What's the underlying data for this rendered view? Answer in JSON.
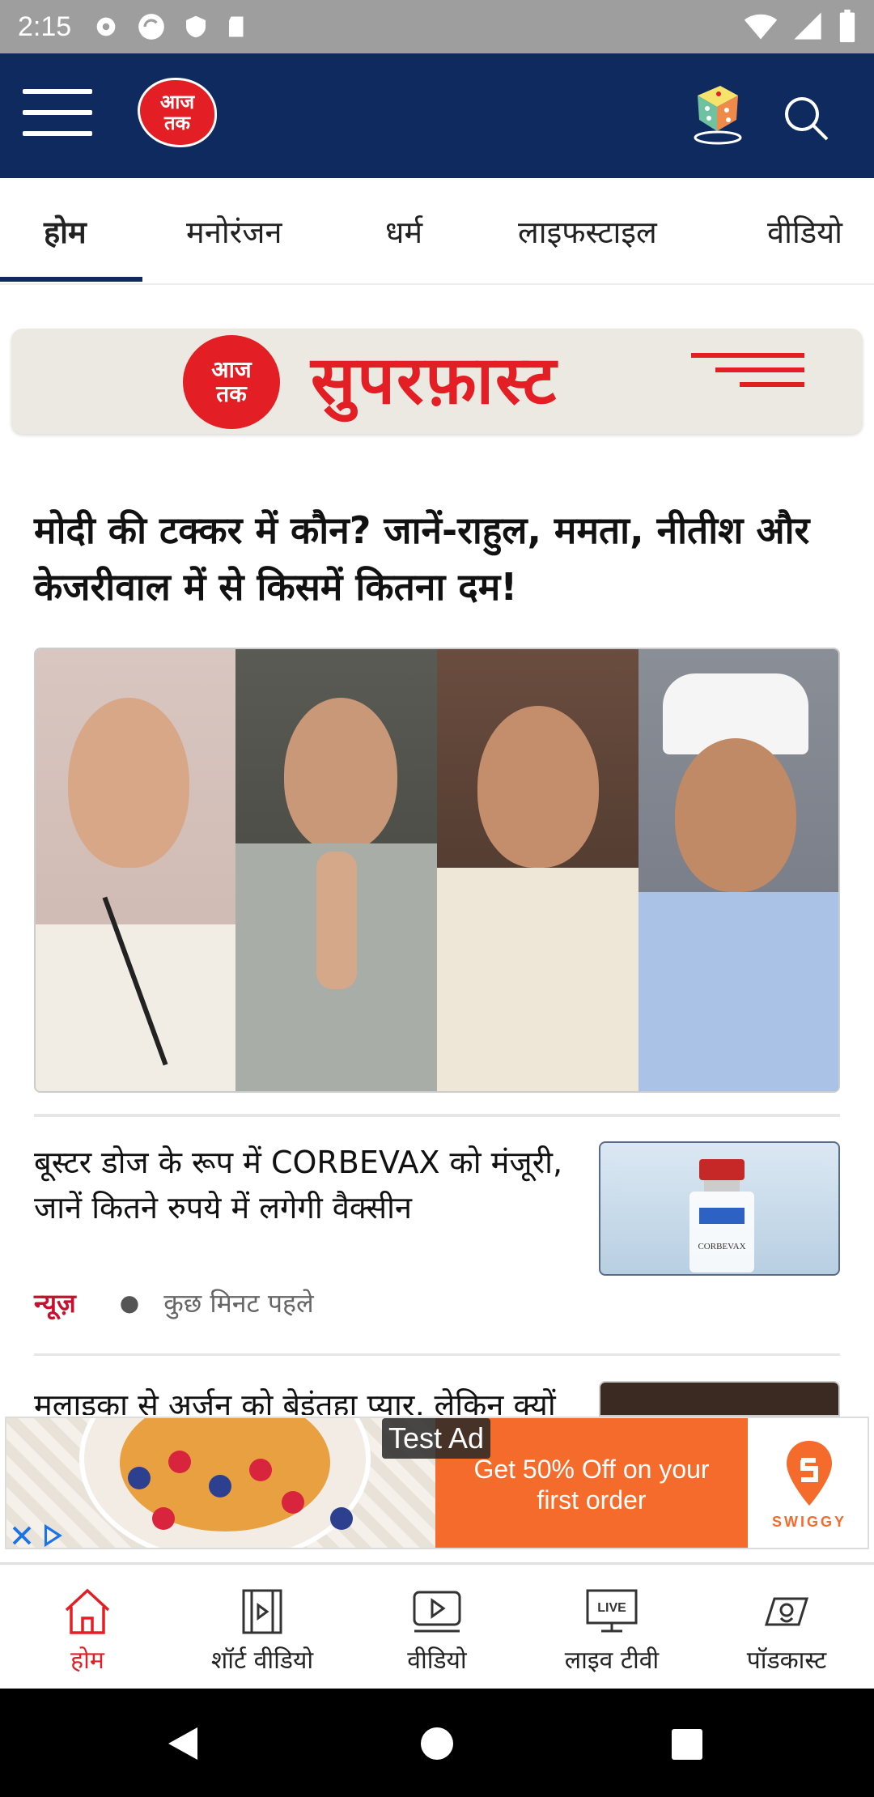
{
  "status_bar": {
    "time": "2:15",
    "left_icons": [
      "settings-icon",
      "sync-icon",
      "shield-icon",
      "sd-card-icon"
    ],
    "right_icons": [
      "wifi-icon",
      "signal-icon",
      "battery-icon"
    ]
  },
  "header": {
    "logo_text_line1": "आज",
    "logo_text_line2": "तक",
    "icons": [
      "menu-icon",
      "dice-icon",
      "search-icon"
    ]
  },
  "tabs": [
    {
      "label": "होम",
      "active": true
    },
    {
      "label": "मनोरंजन",
      "active": false
    },
    {
      "label": "धर्म",
      "active": false
    },
    {
      "label": "लाइफस्टाइल",
      "active": false
    },
    {
      "label": "वीडियो",
      "active": false
    }
  ],
  "superfast": {
    "logo_line1": "आज",
    "logo_line2": "तक",
    "title": "सुपरफ़ास्ट"
  },
  "headline": "मोदी की टक्कर में कौन? जानें-राहुल, ममता, नीतीश और केजरीवाल में से किसमें कितना दम!",
  "stories": [
    {
      "title": "बूस्टर डोज के रूप में CORBEVAX को मंजूरी, जानें कितने रुपये में लगेगी वैक्सीन",
      "category": "न्यूज़",
      "time": "कुछ मिनट पहले",
      "thumb_text": "CORBEVAX"
    },
    {
      "title": "मलाइका से अर्जुन को बेइंतहा प्यार, लेकिन क्यों"
    }
  ],
  "ad": {
    "label": "Test Ad",
    "offer_line1": "Get 50% Off on your",
    "offer_line2": "first order",
    "brand": "SWIGGY"
  },
  "bottom_nav": [
    {
      "label": "होम",
      "icon": "home-icon",
      "active": true
    },
    {
      "label": "शॉर्ट वीडियो",
      "icon": "short-video-icon",
      "active": false
    },
    {
      "label": "वीडियो",
      "icon": "video-play-icon",
      "active": false
    },
    {
      "label": "लाइव टीवी",
      "icon": "live-tv-icon",
      "active": false,
      "badge": "LIVE"
    },
    {
      "label": "पॉडकास्ट",
      "icon": "podcast-icon",
      "active": false
    }
  ],
  "colors": {
    "header_bg": "#0f2a5f",
    "brand_red": "#e31e24",
    "ad_orange": "#f46b2b"
  }
}
